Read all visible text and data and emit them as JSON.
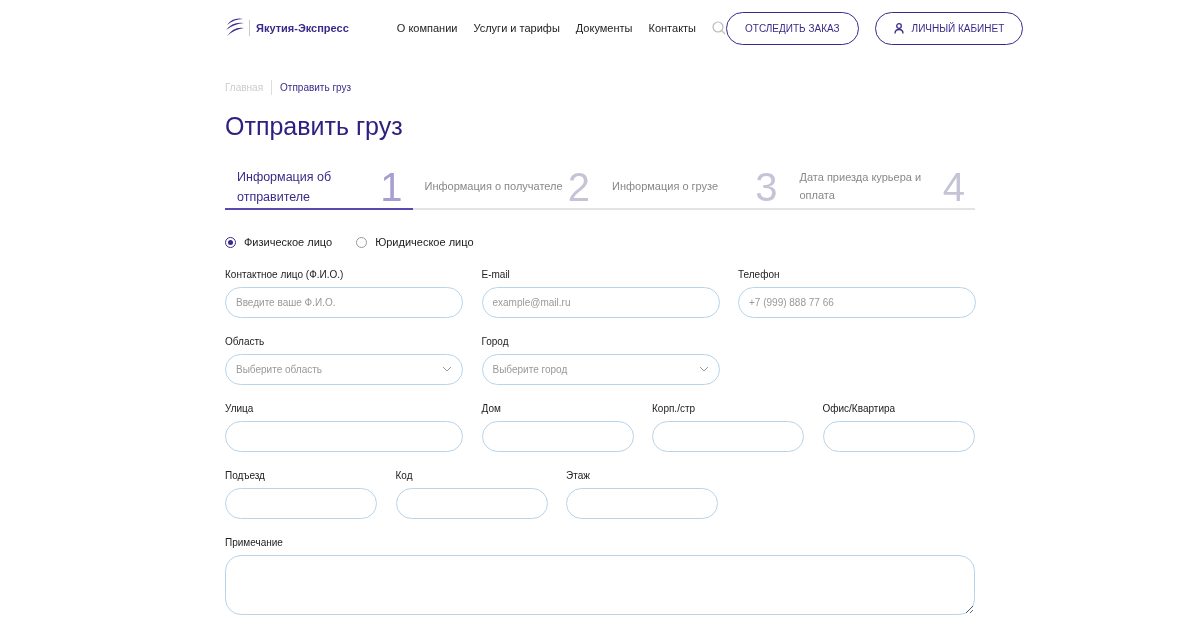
{
  "header": {
    "logo_text": "Якутия-Экспресс",
    "nav": [
      "О компании",
      "Услуги и тарифы",
      "Документы",
      "Контакты"
    ],
    "track_button": "ОТСЛЕДИТЬ ЗАКАЗ",
    "account_button": "ЛИЧНЫЙ КАБИНЕТ"
  },
  "breadcrumbs": [
    {
      "label": "Главная",
      "selected": false
    },
    {
      "label": "Отправить груз",
      "selected": true
    }
  ],
  "title": "Отправить груз",
  "steps": [
    {
      "label": "Информация об отправителе",
      "number": "1",
      "selected": true
    },
    {
      "label": "Информация о получателе",
      "number": "2",
      "selected": false
    },
    {
      "label": "Информация о грузе",
      "number": "3",
      "selected": false
    },
    {
      "label": "Дата приезда курьера и оплата",
      "number": "4",
      "selected": false
    }
  ],
  "person_type": [
    {
      "label": "Физическое лицо",
      "selected": true
    },
    {
      "label": "Юридическое лицо",
      "selected": false
    }
  ],
  "field_rows": [
    [
      {
        "label": "Контактное лицо (Ф.И.О.)",
        "kind": "wideinput",
        "placeholder": "Введите ваше Ф.И.О."
      },
      {
        "label": "E-mail",
        "kind": "wideinput",
        "placeholder": "example@mail.ru"
      },
      {
        "label": "Телефон",
        "kind": "wideinput",
        "placeholder": "+7 (999) 888 77 66"
      }
    ],
    [
      {
        "label": "Область",
        "kind": "select",
        "placeholder": "Выберите область"
      },
      {
        "label": "Город",
        "kind": "select",
        "placeholder": "Выберите город"
      }
    ],
    [
      {
        "label": "Улица",
        "kind": "wideinput"
      },
      {
        "label": "Дом",
        "kind": "narrowinput"
      },
      {
        "label": "Корп./стр",
        "kind": "narrowinput"
      },
      {
        "label": "Офис/Квартира",
        "kind": "narrowinput"
      }
    ],
    [
      {
        "label": "Подъезд",
        "kind": "narrowinput"
      },
      {
        "label": "Код",
        "kind": "narrowinput"
      },
      {
        "label": "Этаж",
        "kind": "narrowinput"
      }
    ],
    [
      {
        "label": "Примечание",
        "kind": "textarea"
      }
    ]
  ]
}
